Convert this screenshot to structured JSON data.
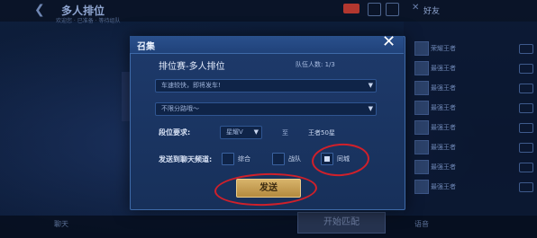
{
  "lobby": {
    "title": "多人排位",
    "sub_status": "欢迎您 · 已准备 · 等待组队",
    "friends_tab": "好友",
    "start_match_label": "开始匹配",
    "bottom_items": [
      "聊天",
      "语音"
    ],
    "friend_names": [
      "荣耀王者",
      "最强王者",
      "最强王者",
      "最强王者",
      "最强王者",
      "最强王者",
      "最强王者",
      "最强王者"
    ]
  },
  "dialog": {
    "title": "召集",
    "mode_label": "排位赛-多人排位",
    "team_count": "队伍人数: 1/3",
    "message_select": {
      "value": "车速较快，即将发车!"
    },
    "position_select": {
      "value": "不限分路哦～"
    },
    "rank_requirement": {
      "label": "段位要求:",
      "from": "星耀V",
      "to_label": "至",
      "to": "王者50星"
    },
    "channels": {
      "label": "发送到聊天频道:",
      "options": [
        {
          "label": "综合",
          "checked": false
        },
        {
          "label": "战队",
          "checked": false
        },
        {
          "label": "同城",
          "checked": true
        }
      ]
    },
    "send_button": "发送",
    "close_icon": "close-icon"
  },
  "colors": {
    "annotation": "#d0202a",
    "send_button": "#c9a158",
    "dialog_bg": "#1c3765"
  }
}
